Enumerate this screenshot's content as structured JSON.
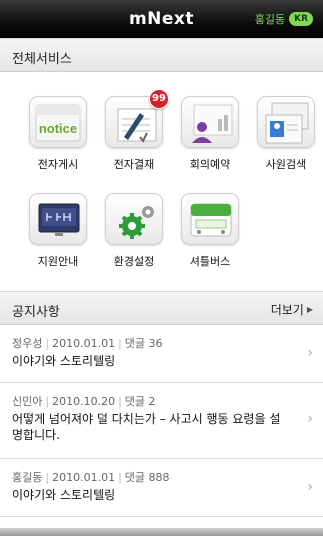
{
  "header": {
    "title": "mNext",
    "user_name": "홍길동",
    "lang_badge": "KR"
  },
  "services": {
    "title": "전체서비스",
    "items": [
      {
        "label": "전자게시",
        "icon": "notice-board-icon",
        "icon_text": "notice"
      },
      {
        "label": "전자결재",
        "icon": "approval-pen-icon",
        "badge": "99"
      },
      {
        "label": "회의예약",
        "icon": "meeting-chart-icon"
      },
      {
        "label": "사원검색",
        "icon": "employee-card-icon"
      },
      {
        "label": "지원안내",
        "icon": "support-monitor-icon"
      },
      {
        "label": "환경설정",
        "icon": "settings-gear-icon"
      },
      {
        "label": "셔틀버스",
        "icon": "shuttle-bus-icon"
      }
    ]
  },
  "notices": {
    "title": "공지사항",
    "more_label": "더보기",
    "items": [
      {
        "author": "정우성",
        "date": "2010.01.01",
        "comments": "댓글 36",
        "title": "이야기와 스토리텔링"
      },
      {
        "author": "신민아",
        "date": "2010.10.20",
        "comments": "댓글 2",
        "title": "어떻게 넘어져야 덜 다치는가 – 사고시 행동 요령을 설명합니다."
      },
      {
        "author": "홍길동",
        "date": "2010.01.01",
        "comments": "댓글 888",
        "title": "이야기와 스토리텔링"
      }
    ]
  },
  "colors": {
    "accent_green": "#7ed957",
    "badge_red": "#d6212b",
    "topbar": "#111111"
  }
}
